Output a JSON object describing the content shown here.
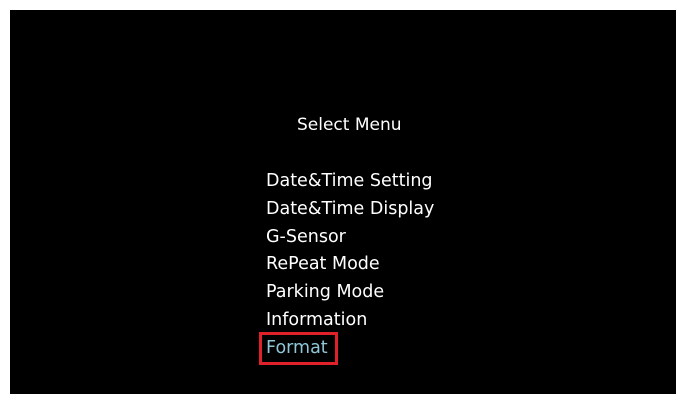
{
  "screen": {
    "title": "Select Menu",
    "menu_items": [
      {
        "label": "Date&Time Setting",
        "selected": false
      },
      {
        "label": "Date&Time Display",
        "selected": false
      },
      {
        "label": "G-Sensor",
        "selected": false
      },
      {
        "label": "RePeat Mode",
        "selected": false
      },
      {
        "label": "Parking Mode",
        "selected": false
      },
      {
        "label": "Information",
        "selected": false
      },
      {
        "label": "Format",
        "selected": true
      }
    ]
  },
  "colors": {
    "background": "#000000",
    "text": "#ffffff",
    "selected_text": "#8ec7d9",
    "highlight_border": "#e0212a"
  }
}
